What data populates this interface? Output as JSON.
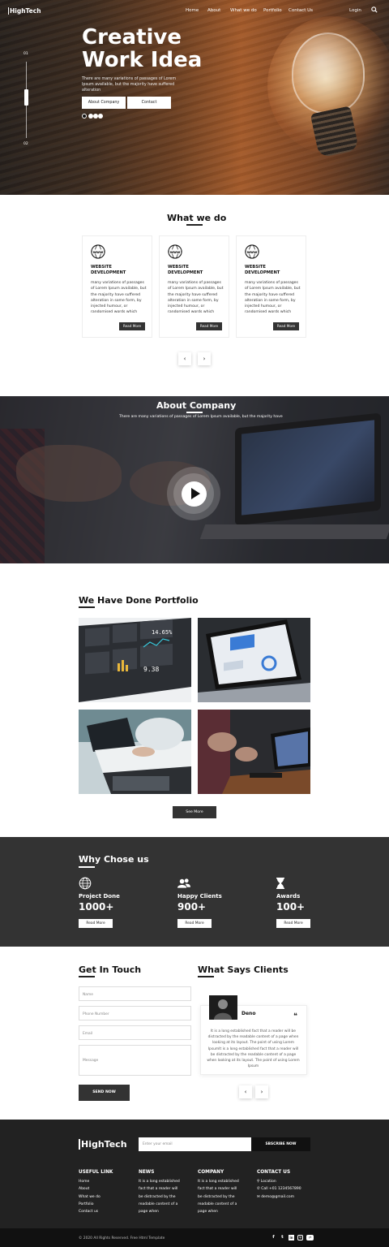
{
  "nav": {
    "logo": "HighTech",
    "items": [
      "Home",
      "About",
      "What we do",
      "Portfolio",
      "Contact Us"
    ],
    "login": "Login"
  },
  "hero": {
    "title_line1": "Creative",
    "title_line2": "Work Idea",
    "subtitle": "There are many variations of passages of Lorem Ipsum available, but the majority have suffered alteration",
    "btn_about": "About Company",
    "btn_contact": "Contact",
    "slide_current": "01",
    "slide_total": "02"
  },
  "whatwedo": {
    "title": "What we do",
    "cards": [
      {
        "title1": "WEBSITE",
        "title2": "DEVELOPMENT",
        "text": "many variations of passages of Lorem Ipsum available, but the majority have suffered alteration in some form, by injected humour, or randomised words which",
        "btn": "Read More"
      },
      {
        "title1": "WEBSITE",
        "title2": "DEVELOPMENT",
        "text": "many variations of passages of Lorem Ipsum available, but the majority have suffered alteration in some form, by injected humour, or randomised words which",
        "btn": "Read More"
      },
      {
        "title1": "WEBSITE",
        "title2": "DEVELOPMENT",
        "text": "many variations of passages of Lorem Ipsum available, but the majority have suffered alteration in some form, by injected humour, or randomised words which",
        "btn": "Read More"
      }
    ],
    "prev": "‹",
    "next": "›"
  },
  "about": {
    "title": "About Company",
    "subtitle": "There are many variations of passages of Lorem Ipsum available, but the majority have"
  },
  "portfolio": {
    "title": "We Have Done Portfolio",
    "btn": "See More",
    "dash_reading1": "14.65%",
    "dash_reading2": "9.38"
  },
  "why": {
    "title": "Why Chose us",
    "items": [
      {
        "label": "Project Done",
        "value": "1000+",
        "btn": "Read More"
      },
      {
        "label": "Happy Clients",
        "value": "900+",
        "btn": "Read More"
      },
      {
        "label": "Awards",
        "value": "100+",
        "btn": "Read More"
      }
    ]
  },
  "contact": {
    "title": "Get In Touch",
    "placeholders": {
      "name": "Name",
      "phone": "Phone Number",
      "email": "Email",
      "message": "Message"
    },
    "send": "SEND NOW"
  },
  "testimonials": {
    "title": "What Says Clients",
    "name": "Deno",
    "quote_mark": "❝",
    "text": "It is a long established fact that a reader will be distracted by the readable content of a page when looking at its layout. The point of using Lorem IpsumIt is a long established fact that a reader will be distracted by the readable content of a page when looking at its layout. The point of using Lorem Ipsum",
    "prev": "‹",
    "next": "›"
  },
  "footer": {
    "logo": "HighTech",
    "email_placeholder": "Enter your email",
    "subscribe": "SBSCRIBE NOW",
    "useful_head": "USEFUL LINK",
    "useful_links": [
      "Home",
      "About",
      "What we do",
      "Portfolio",
      "Contact us"
    ],
    "news_head": "NEWS",
    "news_lines": [
      "It is a long established",
      "fact that a reader will",
      "be distracted by the",
      "readable content of a",
      "page when"
    ],
    "company_head": "COMPANY",
    "company_lines": [
      "It is a long established",
      "fact that a reader will",
      "be distracted by the",
      "readable content of a",
      "page when"
    ],
    "contact_head": "CONTACT US",
    "contact_location": "Location",
    "contact_phone": "Call +01 1234567890",
    "contact_email": "demo@gmail.com",
    "copyright": "© 2020 All Rights Reserved. Free Html Template",
    "social": [
      "f",
      "t",
      "in",
      "ig",
      "yt"
    ]
  }
}
